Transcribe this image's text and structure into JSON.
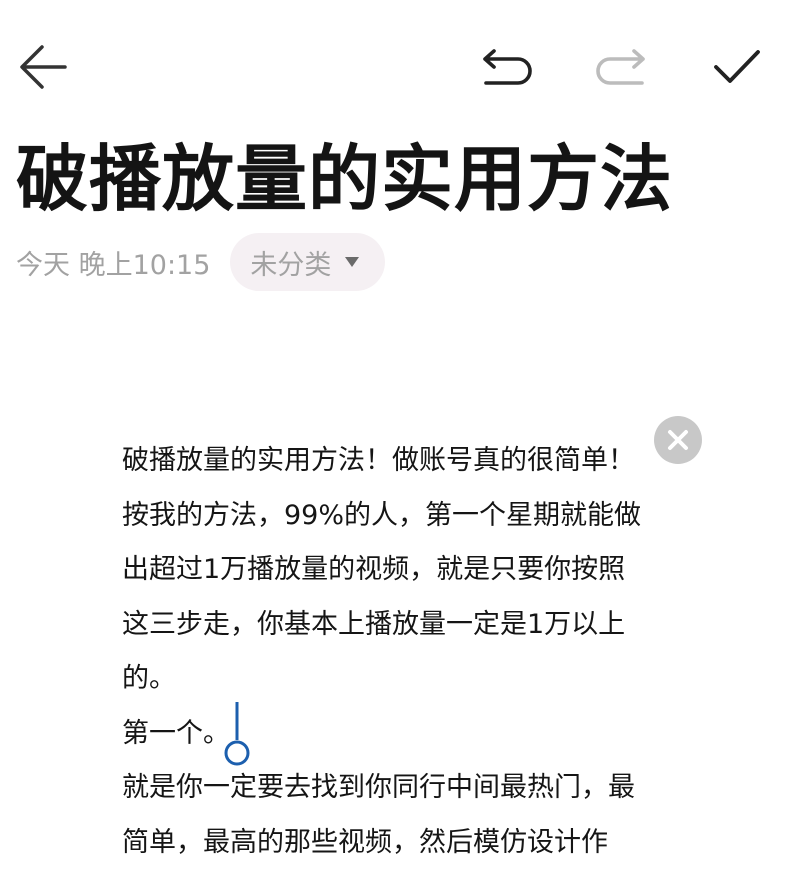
{
  "note": {
    "title": "破播放量的实用方法",
    "date": "今天 晚上10:15",
    "category": "未分类"
  },
  "toolbar": {
    "back_icon": "arrow-left-icon",
    "undo_icon": "undo-icon",
    "redo_icon": "redo-icon",
    "done_icon": "checkmark-icon",
    "redo_disabled": true
  },
  "image_lines": [
    "破播放量的实用方法！做账号真的很简单！",
    "按我的方法，99%的人，第一个星期就能做",
    "出超过1万播放量的视频，就是只要你按照",
    "这三步走，你基本上播放量一定是1万以上",
    "的。",
    "第一个。",
    "就是你一定要去找到你同行中间最热门，最",
    "简单，最高的那些视频，然后模仿设计作"
  ],
  "colors": {
    "accent_blue": "#1c5fae",
    "icon_dark": "#333333",
    "icon_disabled": "#bcbcbc",
    "meta_gray": "#a2a2a2",
    "chip_bg": "#f5f0f3"
  }
}
